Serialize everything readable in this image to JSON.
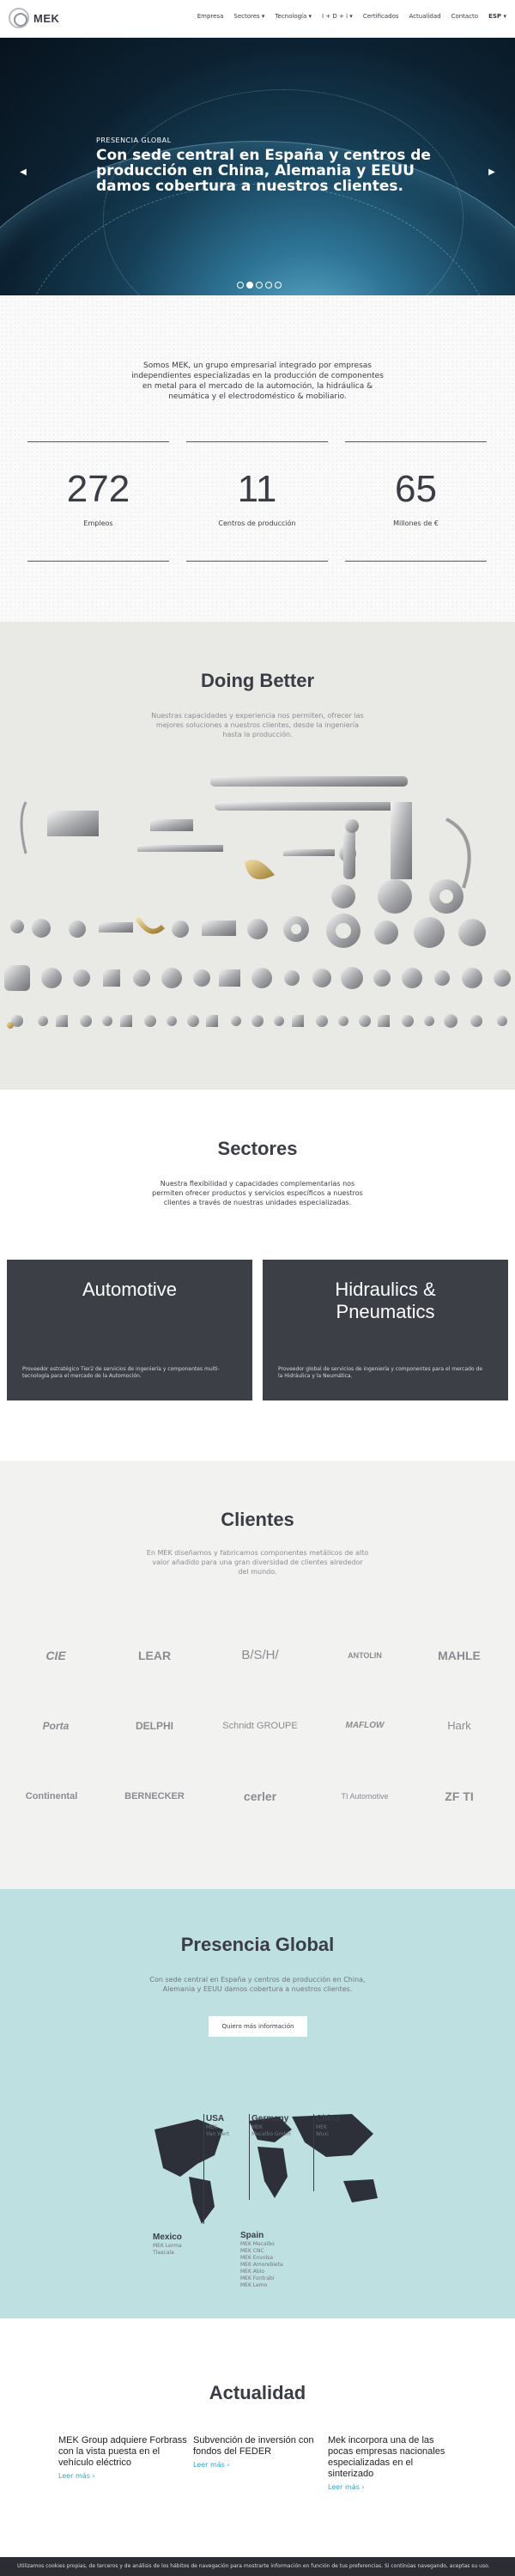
{
  "header": {
    "logo_text": "MEK",
    "nav": [
      "Empresa",
      "Sectores ▾",
      "Tecnología ▾",
      "I + D + i ▾",
      "Certificados",
      "Actualidad",
      "Contacto",
      "ESP ▾"
    ]
  },
  "hero": {
    "eyebrow": "PRESENCIA GLOBAL",
    "title": "Con sede central en España y centros de producción en China, Alemania y EEUU damos cobertura a nuestros clientes."
  },
  "stats": {
    "intro": "Somos MEK, un grupo empresarial integrado por empresas independientes especializadas en la producción de componentes en metal para el mercado de la automoción, la hidráulica & neumática y el electrodoméstico & mobiliario.",
    "items": [
      {
        "value": "272",
        "label": "Empleos"
      },
      {
        "value": "11",
        "label": "Centros de producción"
      },
      {
        "value": "65",
        "label": "Millones de €"
      }
    ]
  },
  "doing": {
    "title": "Doing Better",
    "subtitle": "Nuestras capacidades y experiencia nos permiten, ofrecer las mejores soluciones a nuestros clientes, desde la ingeniería hasta la producción."
  },
  "sectores": {
    "title": "Sectores",
    "subtitle": "Nuestra flexibilidad y capacidades complementarias nos permiten ofrecer productos y servicios específicos a nuestros clientes a través de nuestras unidades especializadas.",
    "cards": [
      {
        "title": "Automotive",
        "desc": "Proveedor estratégico Tier2 de servicios de ingeniería y componentes multi-tecnología para el mercado de la Automoción."
      },
      {
        "title": "Hidraulics & Pneumatics",
        "desc": "Proveedor global de servicios de ingeniería y componentes para el mercado de la Hidráulica y la Neumática."
      }
    ]
  },
  "clientes": {
    "title": "Clientes",
    "subtitle": "En MEK diseñamos y fabricamos componentes metálicos de alto valor añadido para una gran diversidad de clientes alrededor del mundo.",
    "logos": [
      "CIE",
      "LEAR",
      "B/S/H/",
      "ANTOLIN",
      "MAHLE",
      "Porta",
      "DELPHI",
      "Schnidt GROUPE",
      "MAFLOW",
      "Hark",
      "Continental",
      "BERNECKER",
      "cerler",
      "TI Automotive",
      "ZF TI"
    ]
  },
  "presencia": {
    "title": "Presencia Global",
    "subtitle": "Con sede central en España y centros de producción en China, Alemania y EEUU damos cobertura a nuestros clientes.",
    "cta": "Quiero más información",
    "offices": [
      {
        "name": "USA",
        "lines": [
          "MEK",
          "Van Wert"
        ]
      },
      {
        "name": "Germany",
        "lines": [
          "MEK",
          "Mecalbo GmbH"
        ]
      },
      {
        "name": "China",
        "lines": [
          "MEK",
          "Wuxi"
        ]
      },
      {
        "name": "Mexico",
        "lines": [
          "MEK Lerma",
          "Tlaxcala"
        ]
      },
      {
        "name": "Spain",
        "lines": [
          "MEK Mecalbo",
          "MEK CNC",
          "MEK Envolsa",
          "MEK Amorebieta",
          "MEK Abio",
          "MEK Fontrabi",
          "MEK Lemo"
        ]
      }
    ]
  },
  "actualidad": {
    "title": "Actualidad",
    "news": [
      {
        "title": "MEK Group adquiere Forbrass con la vista puesta en el vehículo eléctrico",
        "link": "Leer más"
      },
      {
        "title": "Subvención de inversión con fondos del FEDER",
        "link": "Leer más"
      },
      {
        "title": "Mek incorpora una de las pocas empresas nacionales especializadas en el sinterizado",
        "link": "Leer más"
      }
    ]
  },
  "cookie": {
    "text": "Utilizamos cookies propias, de terceros y de análisis de los hábitos de navegación para mostrarte información en función de tus preferencias. Si continúas navegando, aceptas su uso."
  }
}
